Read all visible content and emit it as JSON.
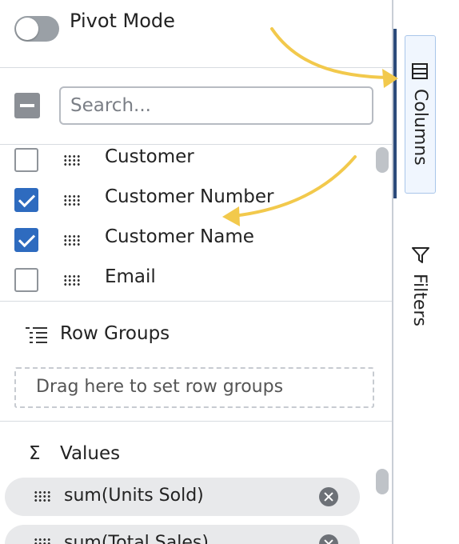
{
  "pivot_mode": {
    "label": "Pivot Mode",
    "enabled": false
  },
  "search": {
    "placeholder": "Search...",
    "value": ""
  },
  "columns": [
    {
      "label": "Customer",
      "checked": false
    },
    {
      "label": "Customer Number",
      "checked": true
    },
    {
      "label": "Customer Name",
      "checked": true
    },
    {
      "label": "Email",
      "checked": false
    }
  ],
  "row_groups": {
    "title": "Row Groups",
    "placeholder": "Drag here to set row groups"
  },
  "values": {
    "title": "Values",
    "symbol": "Σ",
    "items": [
      {
        "label": "sum(Units Sold)"
      },
      {
        "label": "sum(Total Sales)"
      }
    ]
  },
  "side_tabs": [
    {
      "label": "Columns",
      "icon": "columns-icon",
      "active": true
    },
    {
      "label": "Filters",
      "icon": "filter-icon",
      "active": false
    }
  ],
  "colors": {
    "accent": "#2e6bbf",
    "annotation_arrow": "#f2c94c",
    "active_tab_border": "#a9c6ea"
  }
}
